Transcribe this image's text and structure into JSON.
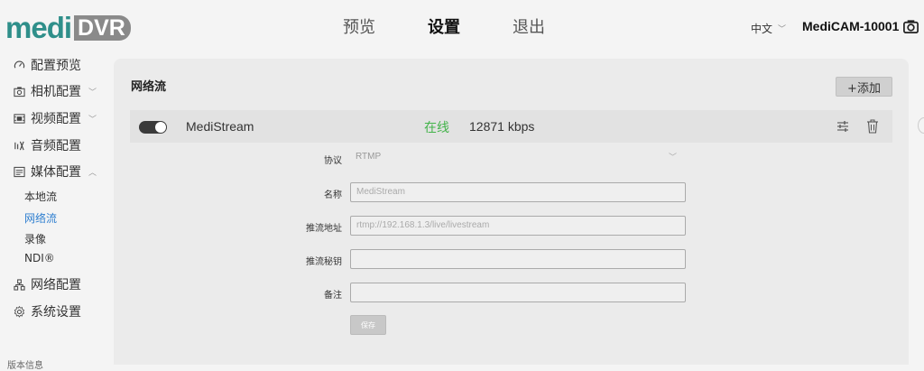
{
  "header": {
    "logo_left": "medi",
    "logo_right": "DVR",
    "nav": [
      "预览",
      "设置",
      "退出"
    ],
    "active_nav": "设置",
    "language": "中文",
    "device_name": "MediCAM-10001"
  },
  "sidebar": {
    "items": [
      {
        "label": "配置预览",
        "icon": "dashboard-icon"
      },
      {
        "label": "相机配置",
        "icon": "camera-icon",
        "expandable": true
      },
      {
        "label": "视频配置",
        "icon": "film-icon",
        "expandable": true
      },
      {
        "label": "音频配置",
        "icon": "audio-icon"
      },
      {
        "label": "媒体配置",
        "icon": "media-icon",
        "expanded": true
      }
    ],
    "media_sub": [
      "本地流",
      "网络流",
      "录像",
      "NDI®"
    ],
    "active_sub": "网络流",
    "more_items": [
      {
        "label": "网络配置",
        "icon": "network-icon"
      },
      {
        "label": "系统设置",
        "icon": "gear-icon"
      }
    ],
    "bottom_text": "版本信息"
  },
  "panel": {
    "title": "网络流",
    "add_label": "+添加",
    "stream": {
      "enabled": true,
      "name": "MediStream",
      "status": "在线",
      "bitrate": "12871 kbps"
    },
    "form": {
      "protocol_label": "协议",
      "protocol_value": "RTMP",
      "name_label": "名称",
      "name_value": "MediStream",
      "url_label": "推流地址",
      "url_value": "rtmp://192.168.1.3/live/livestream",
      "key_label": "推流秘钥",
      "key_value": "",
      "note_label": "备注",
      "note_value": "",
      "save_label": "保存"
    }
  },
  "colors": {
    "brand": "#2f8f8a",
    "online": "#43b34a",
    "active_link": "#2f7fd0"
  }
}
